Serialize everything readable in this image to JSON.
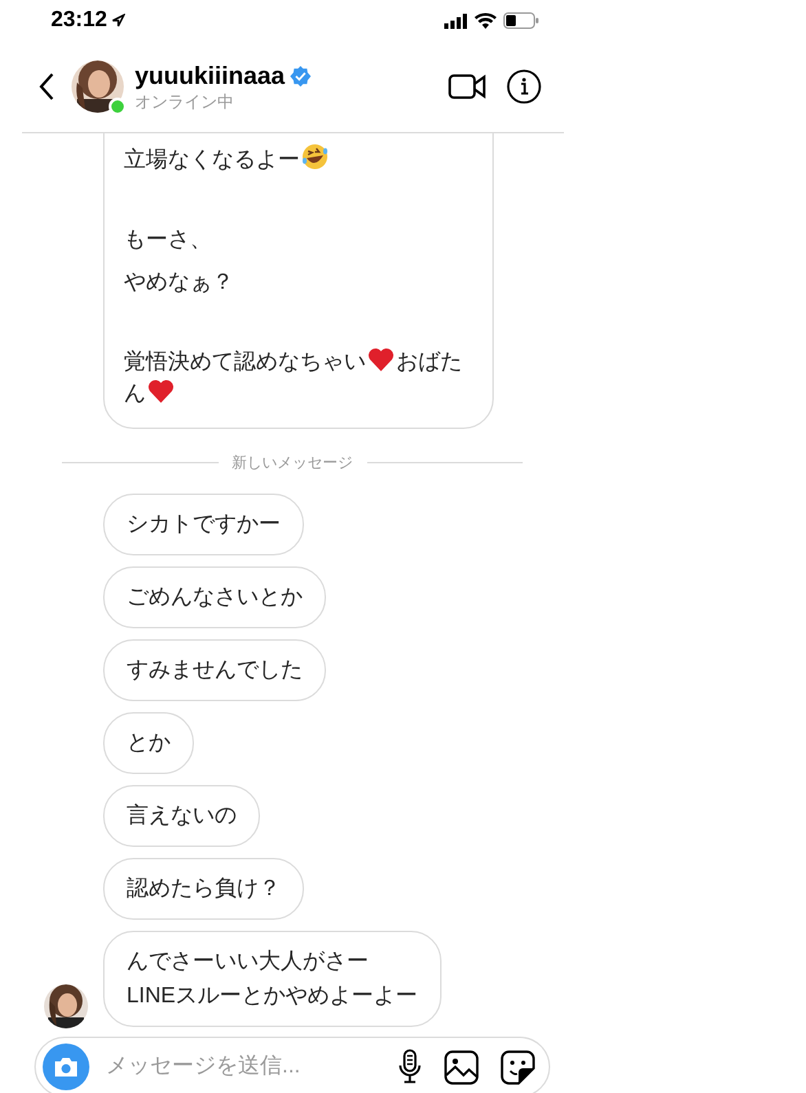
{
  "status_bar": {
    "time": "23:12"
  },
  "header": {
    "username": "yuuukiiinaaa",
    "verified": true,
    "online": true,
    "status": "オンライン中"
  },
  "long_message": {
    "paragraphs": [
      [
        [
          {
            "kind": "text",
            "text": "立場なくなるよー"
          },
          {
            "kind": "laugh"
          }
        ]
      ],
      [
        [
          {
            "kind": "text",
            "text": "もーさ、"
          }
        ],
        [
          {
            "kind": "text",
            "text": "やめなぁ？"
          }
        ]
      ],
      [
        [
          {
            "kind": "text",
            "text": "覚悟決めて認めなちゃい"
          },
          {
            "kind": "heart"
          },
          {
            "kind": "text",
            "text": "おばたん"
          },
          {
            "kind": "heart"
          }
        ]
      ]
    ]
  },
  "divider": "新しいメッセージ",
  "messages": [
    {
      "lines": [
        "シカトですかー"
      ],
      "show_avatar": false
    },
    {
      "lines": [
        "ごめんなさいとか"
      ],
      "show_avatar": false
    },
    {
      "lines": [
        "すみませんでした"
      ],
      "show_avatar": false
    },
    {
      "lines": [
        "とか"
      ],
      "show_avatar": false
    },
    {
      "lines": [
        "言えないの"
      ],
      "show_avatar": false
    },
    {
      "lines": [
        "認めたら負け？"
      ],
      "show_avatar": false
    },
    {
      "lines": [
        "んでさーいい大人がさー",
        "LINEスルーとかやめよーよー"
      ],
      "show_avatar": true
    }
  ],
  "composer": {
    "placeholder": "メッセージを送信..."
  }
}
